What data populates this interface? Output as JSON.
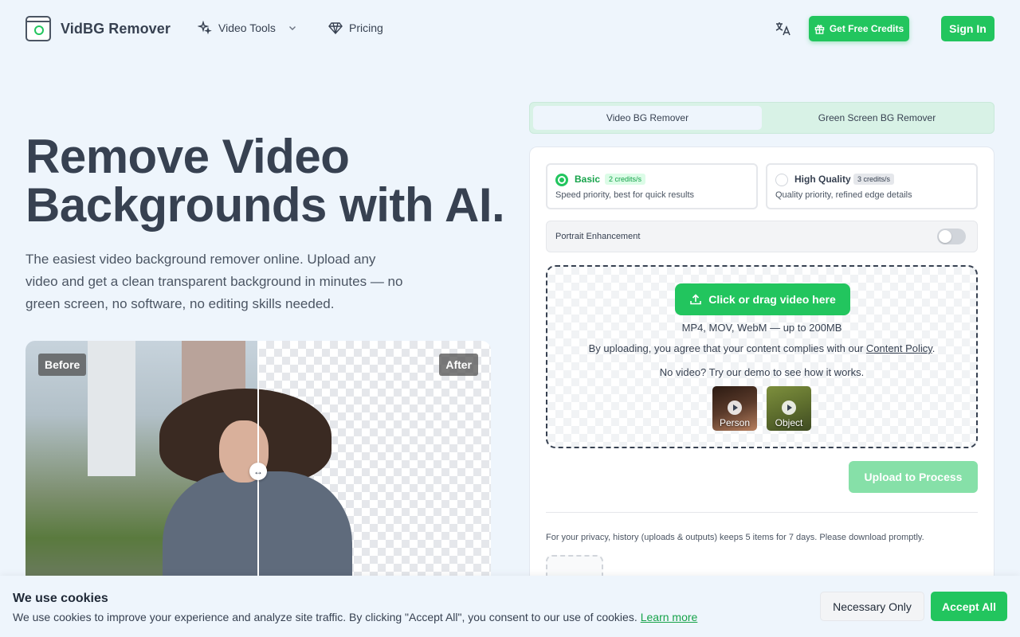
{
  "brand": {
    "name": "VidBG Remover"
  },
  "nav": {
    "video_tools": "Video Tools",
    "pricing": "Pricing",
    "get_credits": "Get Free Credits",
    "sign_in": "Sign In"
  },
  "hero": {
    "title": "Remove Video Backgrounds with AI.",
    "description": "The easiest video background remover online. Upload any video and get a clean transparent background in minutes — no green screen, no software, no editing skills needed.",
    "before_label": "Before",
    "after_label": "After"
  },
  "tabs": [
    {
      "label": "Video BG Remover",
      "active": true
    },
    {
      "label": "Green Screen BG Remover",
      "active": false
    }
  ],
  "modes": {
    "basic": {
      "name": "Basic",
      "badge": "2 credits/s",
      "desc": "Speed priority, best for quick results",
      "selected": true
    },
    "hq": {
      "name": "High Quality",
      "badge": "3 credits/s",
      "desc": "Quality priority, refined edge details",
      "selected": false
    }
  },
  "portrait": {
    "label": "Portrait Enhancement",
    "enabled": false
  },
  "dropzone": {
    "button": "Click or drag video here",
    "formats": "MP4, MOV, WebM — up to 200MB",
    "policy_prefix": "By uploading, you agree that your content complies with our",
    "policy_link": "Content Policy",
    "policy_suffix": ".",
    "demo_text": "No video? Try our demo to see how it works.",
    "demos": [
      {
        "label": "Person"
      },
      {
        "label": "Object"
      }
    ]
  },
  "process": {
    "label": "Upload to Process"
  },
  "privacy": {
    "text": "For your privacy, history (uploads & outputs) keeps 5 items for 7 days. Please download promptly."
  },
  "cookie": {
    "title": "We use cookies",
    "text": "We use cookies to improve your experience and analyze site traffic. By clicking \"Accept All\", you consent to our use of cookies.",
    "learn_more": "Learn more",
    "necessary": "Necessary Only",
    "accept": "Accept All"
  },
  "colors": {
    "accent": "#22c55e",
    "background": "#eef5fc",
    "text": "#374151"
  }
}
